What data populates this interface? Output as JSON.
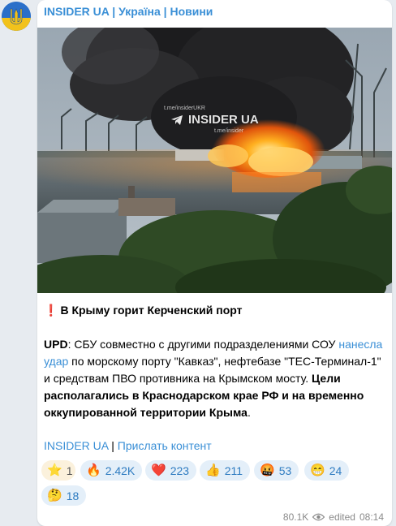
{
  "channel": {
    "name": "INSIDER UA | Україна | Новини"
  },
  "photo": {
    "watermark": "INSIDER UA",
    "watermark_small_1": "t.me/insiderUKR",
    "watermark_small_2": "t.me/insider"
  },
  "post": {
    "headline_icon": "exclamation-icon",
    "headline": "В Крыму горит Керченский порт",
    "upd_label": "UPD",
    "body_1": ": СБУ совместно с другими подразделениями СОУ ",
    "body_link": "нанесла удар",
    "body_2": " по морскому порту \"Кавказ\", нефтебазе \"ТЕС-Терминал-1\" и средствам ПВО противника на Крымском мосту. ",
    "body_bold": "Цели располагались в Краснодарском крае РФ и на временно оккупированной территории Крыма",
    "body_end": "."
  },
  "footer": {
    "link_1": "INSIDER UA",
    "separator": " | ",
    "link_2": "Прислать контент"
  },
  "reactions": [
    {
      "emoji": "⭐",
      "icon": "star-icon",
      "count": "1"
    },
    {
      "emoji": "🔥",
      "icon": "fire-icon",
      "count": "2.42K"
    },
    {
      "emoji": "❤️",
      "icon": "heart-icon",
      "count": "223"
    },
    {
      "emoji": "👍",
      "icon": "thumbs-up-icon",
      "count": "211"
    },
    {
      "emoji": "🤬",
      "icon": "angry-face-icon",
      "count": "53"
    },
    {
      "emoji": "😁",
      "icon": "grin-face-icon",
      "count": "24"
    },
    {
      "emoji": "🤔",
      "icon": "thinking-face-icon",
      "count": "18"
    }
  ],
  "meta": {
    "views": "80.1K",
    "edited_label": "edited",
    "time": "08:14"
  },
  "colors": {
    "link": "#3a8fd6",
    "reaction_bg": "#e4eff9",
    "bubble_bg": "#ffffff",
    "chat_bg": "#e7ebf0"
  }
}
